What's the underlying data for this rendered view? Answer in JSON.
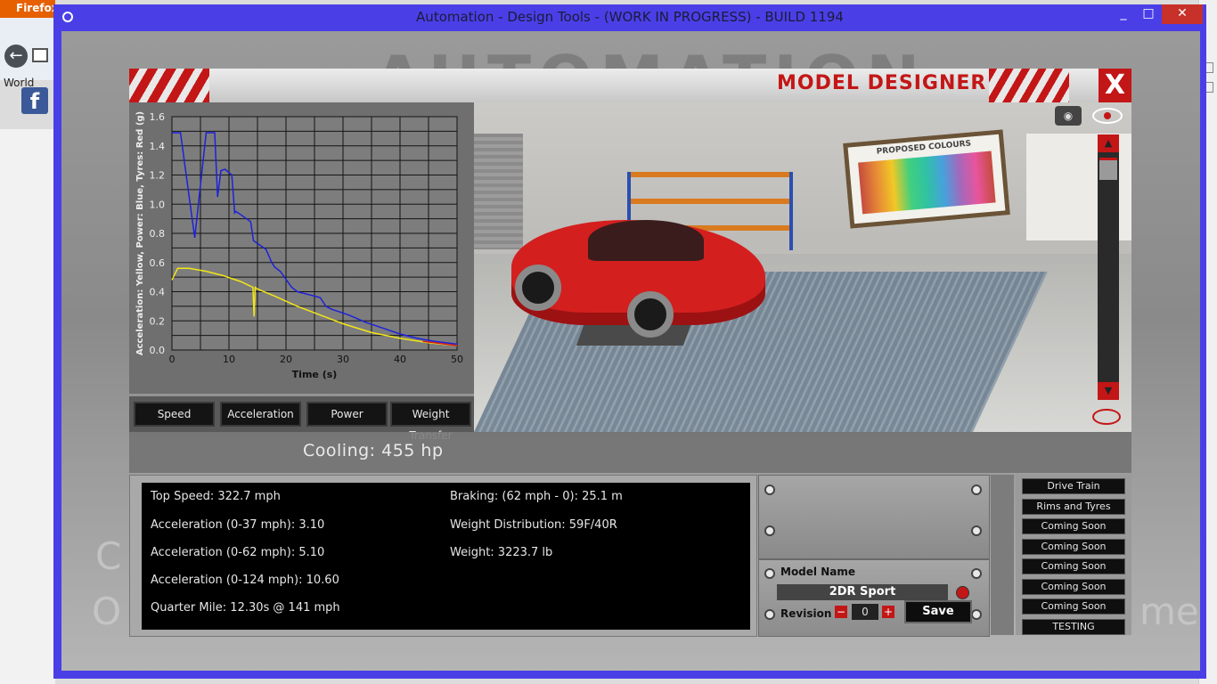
{
  "browser": {
    "tab_label": "Firefox",
    "bookmark_label": "World",
    "facebook_icon": "f"
  },
  "window": {
    "title": "Automation - Design Tools - (WORK IN PROGRESS) - BUILD 1194",
    "minimize": "_",
    "maximize": "□",
    "close": "✕",
    "accent": "#4a3fe6"
  },
  "panel": {
    "title": "MODEL DESIGNER",
    "close_label": "X",
    "accent": "#c31616"
  },
  "chart_data": {
    "type": "line",
    "xlabel": "Time (s)",
    "ylabel": "Acceleration: Yellow, Power: Blue, Tyres: Red (g)",
    "xlim": [
      0,
      50
    ],
    "ylim": [
      0,
      1.6
    ],
    "x_ticks": [
      "0",
      "10",
      "20",
      "30",
      "40",
      "50"
    ],
    "y_ticks": [
      "0.0",
      "0.2",
      "0.4",
      "0.6",
      "0.8",
      "1.0",
      "1.2",
      "1.4",
      "1.6"
    ],
    "grid": true,
    "series": [
      {
        "name": "Power",
        "color": "#1e22d8",
        "x": [
          0,
          1.5,
          2.5,
          4,
          6,
          7.5,
          8,
          8.6,
          9.3,
          10.5,
          11,
          11.2,
          12,
          13.8,
          14.3,
          16.5,
          17.5,
          18,
          19,
          21,
          22,
          24,
          26,
          27,
          28,
          31,
          34,
          37,
          40,
          43,
          46,
          48,
          50
        ],
        "y": [
          1.49,
          1.49,
          1.2,
          0.77,
          1.49,
          1.49,
          1.05,
          1.23,
          1.24,
          1.2,
          0.94,
          0.95,
          0.93,
          0.88,
          0.75,
          0.69,
          0.6,
          0.57,
          0.54,
          0.43,
          0.4,
          0.38,
          0.36,
          0.3,
          0.28,
          0.24,
          0.19,
          0.15,
          0.11,
          0.08,
          0.06,
          0.05,
          0.04
        ]
      },
      {
        "name": "Acceleration",
        "color": "#f2e616",
        "x": [
          0,
          1,
          3,
          6,
          9,
          12,
          14.2,
          14.4,
          14.6,
          14.9,
          18,
          22,
          26,
          30,
          35,
          40,
          45,
          50
        ],
        "y": [
          0.48,
          0.56,
          0.56,
          0.54,
          0.51,
          0.47,
          0.43,
          0.23,
          0.43,
          0.42,
          0.37,
          0.3,
          0.24,
          0.18,
          0.12,
          0.08,
          0.05,
          0.03
        ]
      },
      {
        "name": "Tyres",
        "color": "#d81a1a",
        "x": [
          44,
          46,
          48,
          50
        ],
        "y": [
          0.06,
          0.05,
          0.04,
          0.03
        ]
      }
    ]
  },
  "graph_buttons": [
    "Speed",
    "Acceleration",
    "Power",
    "Weight Transfer"
  ],
  "cooling": "Cooling: 455 hp",
  "stats": {
    "top_speed": "Top Speed: 322.7 mph",
    "accel_37": "Acceleration (0-37 mph): 3.10",
    "accel_62": "Acceleration (0-62 mph): 5.10",
    "accel_124": "Acceleration (0-124 mph): 10.60",
    "quarter_mile": "Quarter Mile: 12.30s @ 141 mph",
    "braking": "Braking: (62 mph - 0): 25.1 m",
    "weight_distribution": "Weight Distribution: 59F/40R",
    "weight": "Weight: 3223.7 lb"
  },
  "model": {
    "name_label": "Model Name",
    "name_value": "2DR Sport",
    "revision_label": "Revision",
    "revision_value": "0",
    "minus": "−",
    "plus": "+",
    "save_label": "Save"
  },
  "menu": [
    "Drive Train",
    "Rims and Tyres",
    "Coming Soon",
    "Coming Soon",
    "Coming Soon",
    "Coming Soon",
    "Coming Soon",
    "TESTING"
  ],
  "poster_title": "PROPOSED COLOURS",
  "background": {
    "logo": "AUTOMATION",
    "left_text_1": "C",
    "left_text_2": "O",
    "right_text": "me"
  }
}
